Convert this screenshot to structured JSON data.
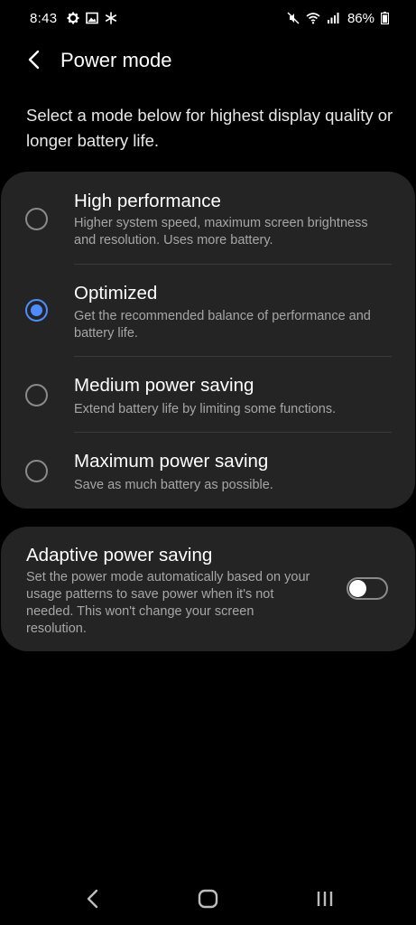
{
  "status_bar": {
    "time": "8:43",
    "battery": "86%",
    "icons_left": [
      "settings-icon",
      "image-icon",
      "snowflake-icon"
    ],
    "icons_right": [
      "mute-icon",
      "wifi-icon",
      "signal-icon",
      "battery-icon"
    ]
  },
  "header": {
    "title": "Power mode"
  },
  "description": "Select a mode below for highest display quality or longer battery life.",
  "modes": [
    {
      "title": "High performance",
      "desc": "Higher system speed, maximum screen brightness and resolution. Uses more battery.",
      "selected": false
    },
    {
      "title": "Optimized",
      "desc": "Get the recommended balance of performance and battery life.",
      "selected": true
    },
    {
      "title": "Medium power saving",
      "desc": "Extend battery life by limiting some functions.",
      "selected": false
    },
    {
      "title": "Maximum power saving",
      "desc": "Save as much battery as possible.",
      "selected": false
    }
  ],
  "adaptive": {
    "title": "Adaptive power saving",
    "desc": "Set the power mode automatically based on your usage patterns to save power when it's not needed. This won't change your screen resolution.",
    "enabled": false
  },
  "colors": {
    "accent": "#4d8cff",
    "card": "#242424",
    "background": "#000000"
  },
  "nav_bar": {
    "buttons": [
      "back-nav-icon",
      "home-icon",
      "recents-icon"
    ]
  }
}
